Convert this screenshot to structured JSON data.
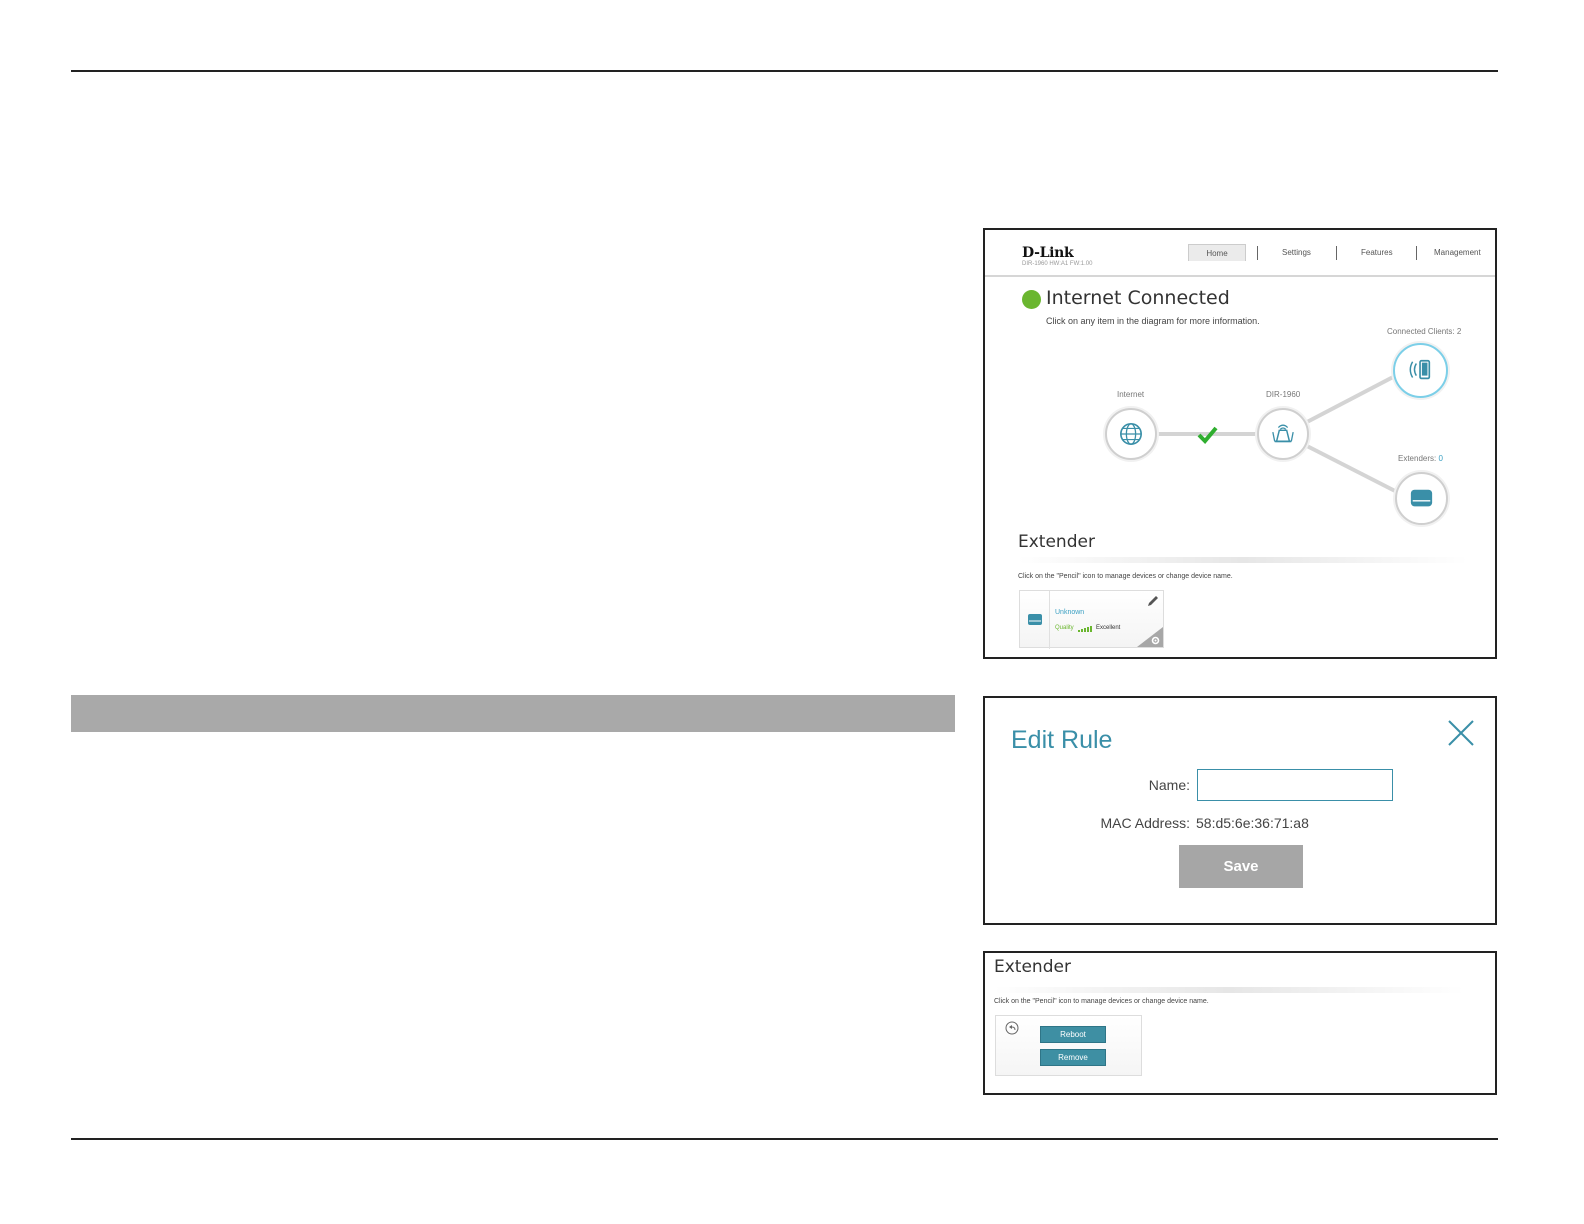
{
  "home_screen": {
    "brand": "D-Link",
    "model_info": "DIR-1960 HW:A1 FW:1.00",
    "nav": {
      "home": "Home",
      "settings": "Settings",
      "features": "Features",
      "management": "Management"
    },
    "status_title": "Internet Connected",
    "status_subtitle": "Click on any item in the diagram for more information.",
    "status_color": "#6ab62f",
    "diagram": {
      "internet_label": "Internet",
      "router_label": "DIR-1960",
      "clients_label": "Connected Clients: 2",
      "extenders_label": "Extenders:",
      "extenders_count": "0"
    },
    "extender_section": {
      "title": "Extender",
      "hint": "Click on the \"Pencil\" icon to manage devices or change device name.",
      "device": {
        "name": "Unknown",
        "quality_label": "Quality",
        "quality_value": "Excellent"
      }
    }
  },
  "edit_rule": {
    "title": "Edit Rule",
    "name_label": "Name:",
    "name_value": "",
    "mac_label": "MAC Address:",
    "mac_value": "58:d5:6e:36:71:a8",
    "save_label": "Save",
    "accent_color": "#3a8fa8"
  },
  "extender_actions": {
    "title": "Extender",
    "hint": "Click on the \"Pencil\" icon to manage devices or change device name.",
    "reboot_label": "Reboot",
    "remove_label": "Remove"
  }
}
